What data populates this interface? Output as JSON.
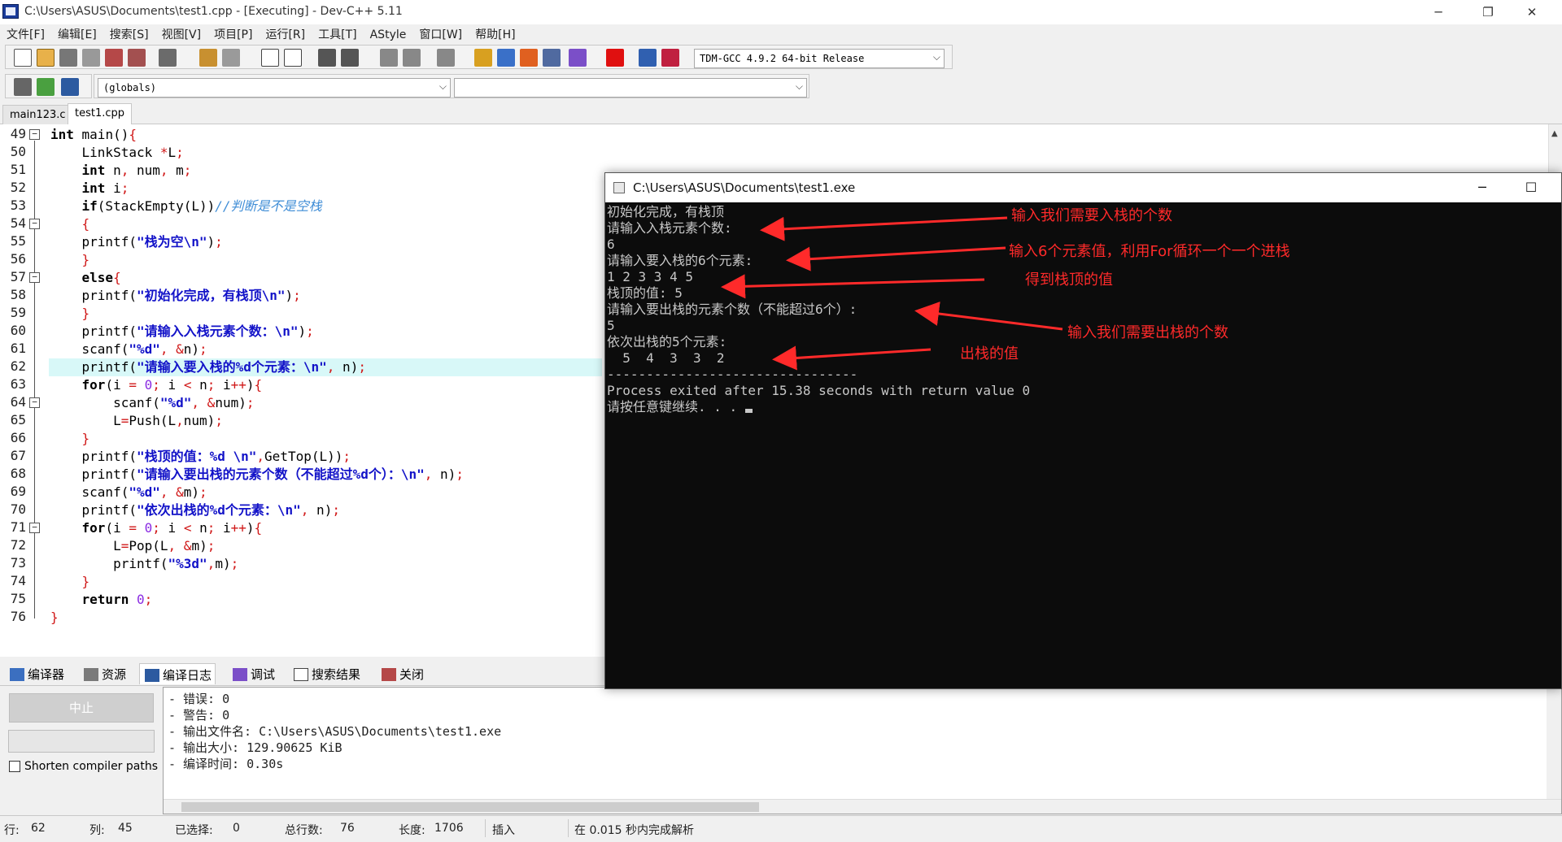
{
  "window": {
    "title": "C:\\Users\\ASUS\\Documents\\test1.cpp - [Executing] - Dev-C++ 5.11",
    "minimize": "─",
    "restore": "❐",
    "close": "✕"
  },
  "menu": [
    "文件[F]",
    "编辑[E]",
    "搜索[S]",
    "视图[V]",
    "项目[P]",
    "运行[R]",
    "工具[T]",
    "AStyle",
    "窗口[W]",
    "帮助[H]"
  ],
  "toolbar": {
    "compiler": "TDM-GCC 4.9.2 64-bit Release",
    "scope": "(globals)",
    "member": ""
  },
  "tabs": [
    "main123.c",
    "test1.cpp"
  ],
  "editor": {
    "line_numbers": [
      "49",
      "50",
      "51",
      "52",
      "53",
      "54",
      "55",
      "56",
      "57",
      "58",
      "59",
      "60",
      "61",
      "62",
      "63",
      "64",
      "65",
      "66",
      "67",
      "68",
      "69",
      "70",
      "71",
      "72",
      "73",
      "74",
      "75",
      "76"
    ],
    "current_line": "62"
  },
  "console": {
    "title": "C:\\Users\\ASUS\\Documents\\test1.exe",
    "minimize": "─",
    "maximize": "☐",
    "lines": [
      "初始化完成，有栈顶",
      "请输入入栈元素个数:",
      "6",
      "请输入要入栈的6个元素:",
      "1 2 3 3 4 5",
      "栈顶的值: 5",
      "请输入要出栈的元素个数（不能超过6个）:",
      "5",
      "依次出栈的5个元素:",
      "  5  4  3  3  2",
      "--------------------------------",
      "Process exited after 15.38 seconds with return value 0",
      "请按任意键继续. . . "
    ]
  },
  "annotations": [
    "输入我们需要入栈的个数",
    "输入6个元素值，利用For循环一个一个进栈",
    "得到栈顶的值",
    "输入我们需要出栈的个数",
    "出栈的值"
  ],
  "bottom_tabs": [
    "编译器",
    "资源",
    "编译日志",
    "调试",
    "搜索结果",
    "关闭"
  ],
  "bottom_panel": {
    "stop_label": "中止",
    "shorten_label": "Shorten compiler paths",
    "log": [
      "- 错误: 0",
      "- 警告: 0",
      "- 输出文件名: C:\\Users\\ASUS\\Documents\\test1.exe",
      "- 输出大小: 129.90625 KiB",
      "- 编译时间: 0.30s"
    ]
  },
  "status": {
    "row_label": "行:",
    "row_value": "62",
    "col_label": "列:",
    "col_value": "45",
    "sel_label": "已选择:",
    "sel_value": "0",
    "total_label": "总行数:",
    "total_value": "76",
    "len_label": "长度:",
    "len_value": "1706",
    "mode": "插入",
    "parse": "在 0.015 秒内完成解析"
  }
}
